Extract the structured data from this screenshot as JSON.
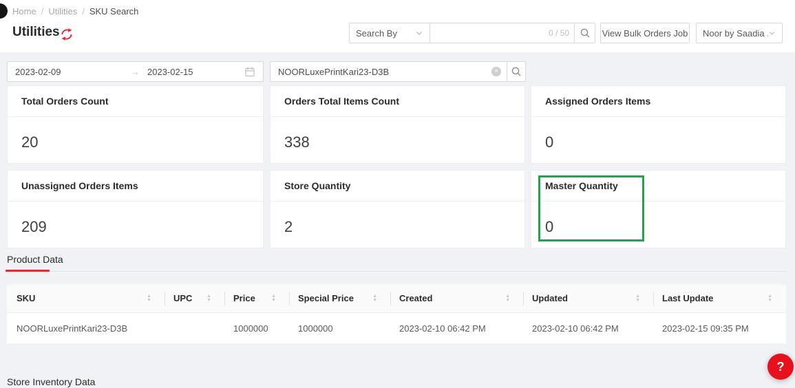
{
  "breadcrumb": {
    "separator": "/",
    "items": [
      {
        "label": "Home"
      },
      {
        "label": "Utilities"
      },
      {
        "label": "SKU Search"
      }
    ]
  },
  "header": {
    "title": "Utilities",
    "search_by_label": "Search By",
    "search_counter": "0 / 50",
    "bulk_button_label": "View Bulk Orders Job",
    "store_select_value": "Noor by Saadia ..."
  },
  "filters": {
    "date_from": "2023-02-09",
    "date_to": "2023-02-15",
    "date_arrow": "→",
    "sku_value": "NOORLuxePrintKari23-D3B"
  },
  "stat_cards": [
    {
      "title": "Total Orders Count",
      "value": "20"
    },
    {
      "title": "Orders Total Items Count",
      "value": "338"
    },
    {
      "title": "Assigned Orders Items",
      "value": "0"
    },
    {
      "title": "Unassigned Orders Items",
      "value": "209"
    },
    {
      "title": "Store Quantity",
      "value": "2"
    },
    {
      "title": "Master Quantity",
      "value": "0",
      "highlighted": true
    }
  ],
  "tabs": {
    "product_data": "Product Data"
  },
  "product_table": {
    "columns": [
      "SKU",
      "UPC",
      "Price",
      "Special Price",
      "Created",
      "Updated",
      "Last Update"
    ],
    "rows": [
      [
        "NOORLuxePrintKari23-D3B",
        "",
        "1000000",
        "1000000",
        "2023-02-10 06:42 PM",
        "2023-02-10 06:42 PM",
        "2023-02-15 09:35 PM"
      ]
    ]
  },
  "store_inventory_label": "Store Inventory Data",
  "help_button_label": "?",
  "icons": {
    "sort_up": "▲",
    "sort_down": "▼",
    "clear": "×"
  },
  "colors": {
    "accent_red": "#f5222d",
    "highlight_green": "#22a449",
    "help_red": "#e8101a"
  }
}
